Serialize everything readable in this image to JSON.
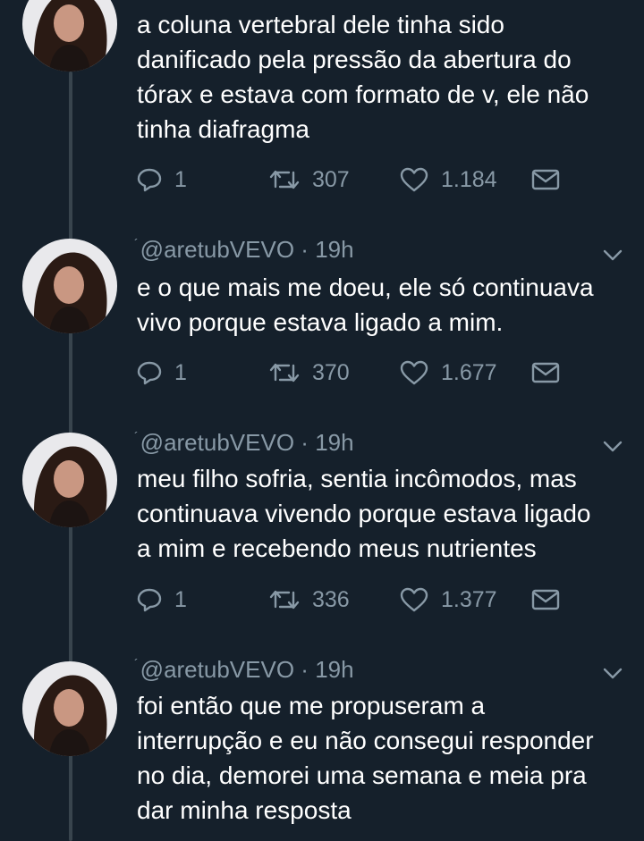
{
  "tweets": [
    {
      "handle": "",
      "time": "",
      "text": [
        "a coluna vertebral dele tinha sido",
        "danificado pela pressão da abertura do",
        "tórax e estava com formato de v, ele não",
        "tinha diafragma"
      ],
      "replies": "1",
      "retweets": "307",
      "likes": "1.184"
    },
    {
      "handle": "@aretubVEVO",
      "separator": "·",
      "time": "19h",
      "text": [
        "e o que mais me doeu, ele só continuava",
        "vivo porque estava ligado a mim."
      ],
      "replies": "1",
      "retweets": "370",
      "likes": "1.677"
    },
    {
      "handle": "@aretubVEVO",
      "separator": "·",
      "time": "19h",
      "text": [
        "meu filho sofria, sentia incômodos, mas",
        "continuava vivendo porque estava ligado",
        "a mim e recebendo meus nutrientes"
      ],
      "replies": "1",
      "retweets": "336",
      "likes": "1.377"
    },
    {
      "handle": "@aretubVEVO",
      "separator": "·",
      "time": "19h",
      "text": [
        "foi então que me propuseram a",
        "interrupção e eu não consegui responder",
        "no dia, demorei uma semana e meia pra",
        "dar minha resposta"
      ]
    }
  ],
  "icons": {
    "reply": "speech-bubble-icon",
    "retweet": "retweet-arrows-icon",
    "like": "heart-icon",
    "dm": "envelope-icon",
    "caret": "chevron-down-icon"
  },
  "colors": {
    "background": "#15202b",
    "text": "#ffffff",
    "muted": "#8899a6",
    "thread_line": "#38444d"
  }
}
